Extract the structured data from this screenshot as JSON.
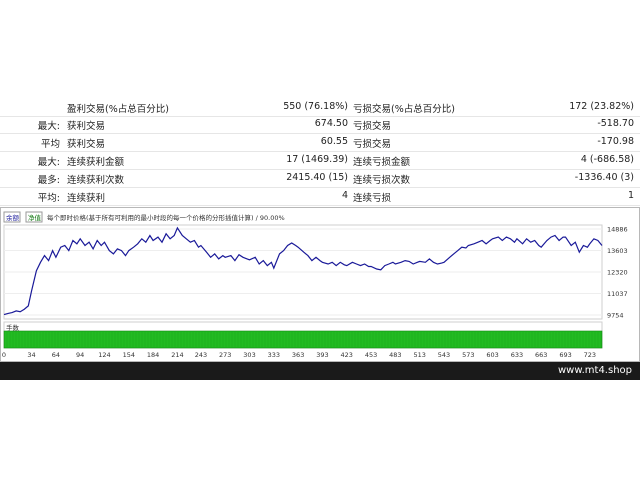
{
  "stats": {
    "rows": [
      {
        "lbl1": "",
        "lbl2": "盈利交易(%占总百分比)",
        "val2": "550 (76.18%)",
        "lbl3": "亏损交易(%占总百分比)",
        "val3": "172 (23.82%)"
      },
      {
        "lbl1": "最大:",
        "lbl2": "获利交易",
        "val2": "674.50",
        "lbl3": "亏损交易",
        "val3": "-518.70"
      },
      {
        "lbl1": "平均",
        "lbl2": "获利交易",
        "val2": "60.55",
        "lbl3": "亏损交易",
        "val3": "-170.98"
      },
      {
        "lbl1": "最大:",
        "lbl2": "连续获利金额",
        "val2": "17 (1469.39)",
        "lbl3": "连续亏损金额",
        "val3": "4 (-686.58)"
      },
      {
        "lbl1": "最多:",
        "lbl2": "连续获利次数",
        "val2": "2415.40 (15)",
        "lbl3": "连续亏损次数",
        "val3": "-1336.40 (3)"
      },
      {
        "lbl1": "平均:",
        "lbl2": "连续获利",
        "val2": "4",
        "lbl3": "连续亏损",
        "val3": "1"
      }
    ]
  },
  "chart_header": {
    "balance_label": "余额",
    "equity_label": "净值",
    "description": "每个即时价格(基于所有可利用的最小时段的每一个价格的分形插值计算) / 90.00%"
  },
  "lots_label": "手数",
  "footer": {
    "site": "www.mt4.shop"
  },
  "colors": {
    "balance_line": "#1a1a99",
    "lots_fill": "#22bb22",
    "lots_edge": "#118811",
    "footer_bg": "#1a1a1a"
  },
  "chart_data": {
    "type": "line",
    "title": "",
    "y_ticks": [
      "14886",
      "13603",
      "12320",
      "11037",
      "9754"
    ],
    "x_ticks": [
      "0",
      "34",
      "64",
      "94",
      "124",
      "154",
      "184",
      "214",
      "243",
      "273",
      "303",
      "333",
      "363",
      "393",
      "423",
      "453",
      "483",
      "513",
      "543",
      "573",
      "603",
      "633",
      "663",
      "693",
      "723"
    ],
    "ylim": [
      9754,
      14886
    ],
    "xlim": [
      0,
      738
    ],
    "series": [
      {
        "values": [
          [
            0,
            9780
          ],
          [
            5,
            9850
          ],
          [
            10,
            9900
          ],
          [
            15,
            10000
          ],
          [
            20,
            9950
          ],
          [
            25,
            10100
          ],
          [
            30,
            10300
          ],
          [
            34,
            11200
          ],
          [
            40,
            12400
          ],
          [
            45,
            12900
          ],
          [
            50,
            13300
          ],
          [
            55,
            13000
          ],
          [
            60,
            13600
          ],
          [
            64,
            13200
          ],
          [
            70,
            13800
          ],
          [
            75,
            13900
          ],
          [
            80,
            13600
          ],
          [
            85,
            14200
          ],
          [
            90,
            14000
          ],
          [
            94,
            14300
          ],
          [
            100,
            13900
          ],
          [
            105,
            14100
          ],
          [
            110,
            13700
          ],
          [
            115,
            14200
          ],
          [
            120,
            13900
          ],
          [
            124,
            14100
          ],
          [
            130,
            13600
          ],
          [
            135,
            13400
          ],
          [
            140,
            13700
          ],
          [
            145,
            13600
          ],
          [
            150,
            13300
          ],
          [
            154,
            13600
          ],
          [
            160,
            13800
          ],
          [
            165,
            14000
          ],
          [
            170,
            14300
          ],
          [
            175,
            14100
          ],
          [
            180,
            14500
          ],
          [
            184,
            14200
          ],
          [
            190,
            14400
          ],
          [
            195,
            14100
          ],
          [
            200,
            14600
          ],
          [
            205,
            14300
          ],
          [
            210,
            14500
          ],
          [
            214,
            14950
          ],
          [
            220,
            14500
          ],
          [
            225,
            14300
          ],
          [
            230,
            14100
          ],
          [
            235,
            14200
          ],
          [
            240,
            13800
          ],
          [
            243,
            13900
          ],
          [
            250,
            13500
          ],
          [
            255,
            13200
          ],
          [
            260,
            13400
          ],
          [
            265,
            13100
          ],
          [
            270,
            13300
          ],
          [
            273,
            13200
          ],
          [
            280,
            13300
          ],
          [
            285,
            13000
          ],
          [
            290,
            13350
          ],
          [
            295,
            13200
          ],
          [
            300,
            13100
          ],
          [
            303,
            13050
          ],
          [
            310,
            13200
          ],
          [
            315,
            12800
          ],
          [
            320,
            13000
          ],
          [
            325,
            12700
          ],
          [
            330,
            12900
          ],
          [
            333,
            12550
          ],
          [
            340,
            13400
          ],
          [
            345,
            13600
          ],
          [
            350,
            13900
          ],
          [
            355,
            14050
          ],
          [
            360,
            13900
          ],
          [
            363,
            13800
          ],
          [
            370,
            13500
          ],
          [
            375,
            13300
          ],
          [
            380,
            13000
          ],
          [
            385,
            13200
          ],
          [
            390,
            13000
          ],
          [
            393,
            12900
          ],
          [
            400,
            12800
          ],
          [
            405,
            12900
          ],
          [
            410,
            12700
          ],
          [
            415,
            12900
          ],
          [
            420,
            12750
          ],
          [
            423,
            12700
          ],
          [
            430,
            12900
          ],
          [
            435,
            12800
          ],
          [
            440,
            12700
          ],
          [
            445,
            12800
          ],
          [
            450,
            12650
          ],
          [
            453,
            12650
          ],
          [
            460,
            12500
          ],
          [
            465,
            12450
          ],
          [
            470,
            12700
          ],
          [
            475,
            12800
          ],
          [
            480,
            12900
          ],
          [
            483,
            12800
          ],
          [
            490,
            12900
          ],
          [
            495,
            13000
          ],
          [
            500,
            12950
          ],
          [
            505,
            12800
          ],
          [
            510,
            12900
          ],
          [
            513,
            12950
          ],
          [
            520,
            12900
          ],
          [
            525,
            13100
          ],
          [
            530,
            12900
          ],
          [
            535,
            12800
          ],
          [
            540,
            12850
          ],
          [
            543,
            12900
          ],
          [
            550,
            13200
          ],
          [
            555,
            13400
          ],
          [
            560,
            13600
          ],
          [
            565,
            13800
          ],
          [
            570,
            13750
          ],
          [
            573,
            13900
          ],
          [
            580,
            14000
          ],
          [
            585,
            14100
          ],
          [
            590,
            14200
          ],
          [
            595,
            14000
          ],
          [
            600,
            14200
          ],
          [
            603,
            14300
          ],
          [
            610,
            14400
          ],
          [
            615,
            14200
          ],
          [
            620,
            14400
          ],
          [
            625,
            14300
          ],
          [
            630,
            14100
          ],
          [
            633,
            14300
          ],
          [
            640,
            14000
          ],
          [
            645,
            14300
          ],
          [
            650,
            14100
          ],
          [
            655,
            14200
          ],
          [
            660,
            13900
          ],
          [
            663,
            13800
          ],
          [
            670,
            14200
          ],
          [
            675,
            14400
          ],
          [
            680,
            14500
          ],
          [
            685,
            14200
          ],
          [
            690,
            14400
          ],
          [
            693,
            14400
          ],
          [
            700,
            13900
          ],
          [
            705,
            14100
          ],
          [
            710,
            13500
          ],
          [
            715,
            13900
          ],
          [
            720,
            13800
          ],
          [
            723,
            14000
          ],
          [
            728,
            14300
          ],
          [
            733,
            14200
          ],
          [
            738,
            13900
          ]
        ]
      }
    ]
  }
}
